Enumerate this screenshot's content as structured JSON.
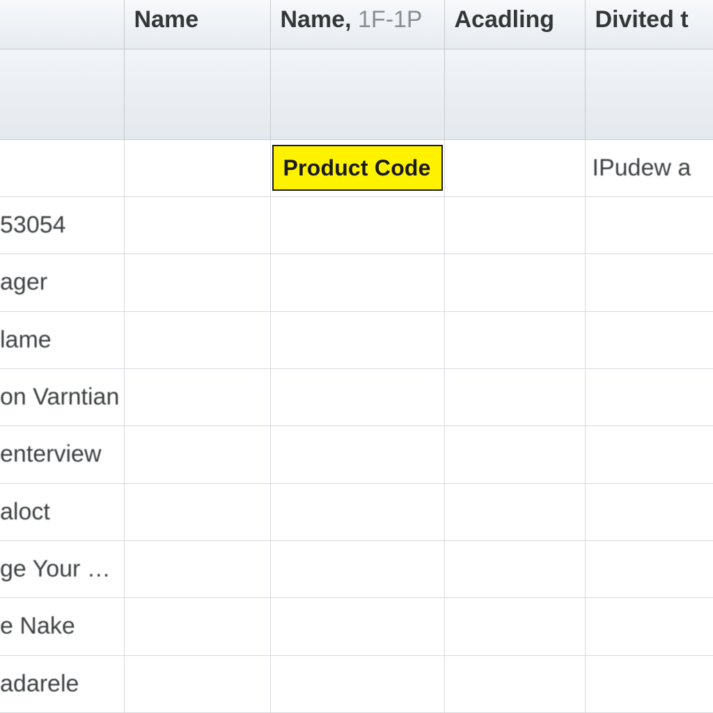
{
  "headers": {
    "col_b": "Name",
    "col_c_main": "Name,",
    "col_c_sub": "1F-1P",
    "col_d": "Acadling",
    "col_e": "Divited t"
  },
  "yellow_cell": "Product Code",
  "rows": [
    {
      "a": "",
      "b": "",
      "c_highlight": true,
      "d": "",
      "e": "IPudew a"
    },
    {
      "a": "53054",
      "b": "",
      "c": "",
      "d": "",
      "e": ""
    },
    {
      "a": "ager",
      "b": "",
      "c": "",
      "d": "",
      "e": ""
    },
    {
      "a": "lame",
      "b": "",
      "c": "",
      "d": "",
      "e": ""
    },
    {
      "a": "on Varntian",
      "b": "",
      "c": "",
      "d": "",
      "e": ""
    },
    {
      "a": "enterview",
      "b": "",
      "c": "",
      "d": "",
      "e": ""
    },
    {
      "a": "aloct",
      "b": "",
      "c": "",
      "d": "",
      "e": ""
    },
    {
      "a": "ge Your …",
      "b": "",
      "c": "",
      "d": "",
      "e": ""
    },
    {
      "a": "e Nake",
      "b": "",
      "c": "",
      "d": "",
      "e": ""
    },
    {
      "a": "adarele",
      "b": "",
      "c": "",
      "d": "",
      "e": ""
    }
  ]
}
